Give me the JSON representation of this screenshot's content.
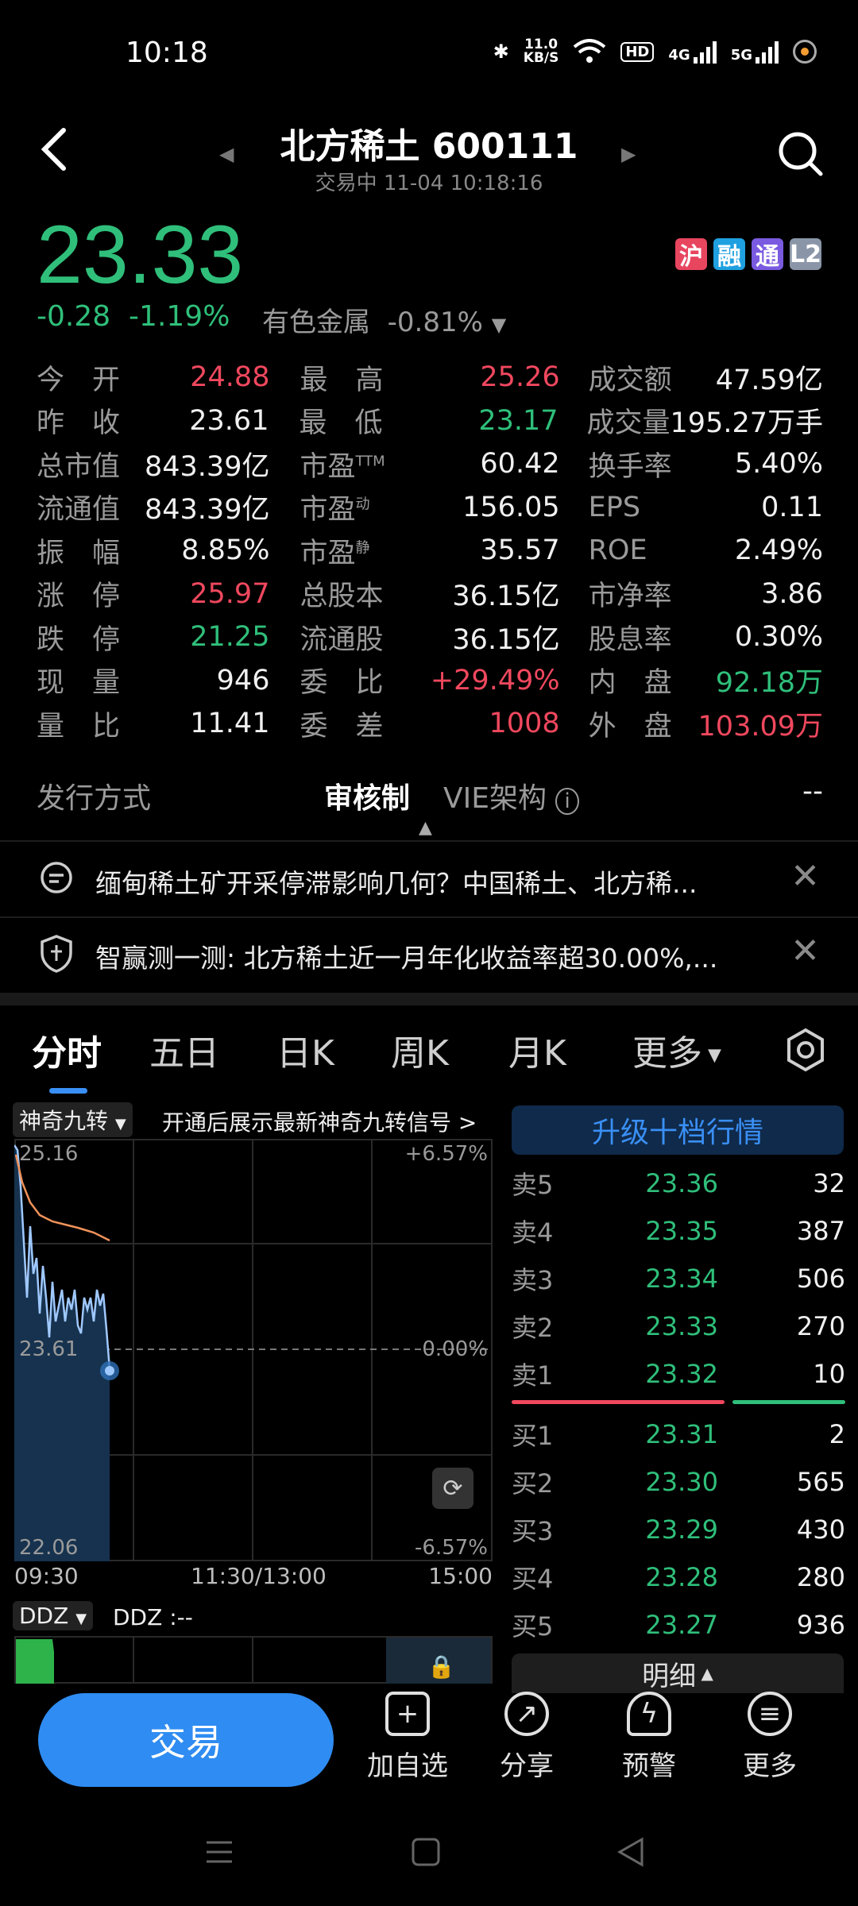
{
  "status": {
    "time": "10:18",
    "speed": "11.0",
    "speed_unit": "KB/S",
    "hd": "HD",
    "net1": "4G",
    "net2": "5G"
  },
  "header": {
    "title": "北方稀土 600111",
    "subtitle": "交易中 11-04 10:18:16"
  },
  "quote": {
    "price": "23.33",
    "change": "-0.28",
    "change_pct": "-1.19%",
    "sector": "有色金属",
    "sector_pct": "-0.81%",
    "tags": [
      "沪",
      "融",
      "通",
      "L2"
    ],
    "tag_colors": [
      "#e8455f",
      "#1fa0e0",
      "#7a5ae0",
      "#8a96a8"
    ]
  },
  "stats": [
    [
      {
        "l": "今　开",
        "v": "24.88",
        "c": "red"
      },
      {
        "l": "最　高",
        "v": "25.26",
        "c": "red"
      },
      {
        "l": "成交额",
        "v": "47.59亿",
        "c": ""
      }
    ],
    [
      {
        "l": "昨　收",
        "v": "23.61",
        "c": ""
      },
      {
        "l": "最　低",
        "v": "23.17",
        "c": "green"
      },
      {
        "l": "成交量",
        "v": "195.27万手",
        "c": ""
      }
    ],
    [
      {
        "l": "总市值",
        "v": "843.39亿",
        "c": ""
      },
      {
        "l": "市盈TTM",
        "v": "60.42",
        "c": ""
      },
      {
        "l": "换手率",
        "v": "5.40%",
        "c": ""
      }
    ],
    [
      {
        "l": "流通值",
        "v": "843.39亿",
        "c": ""
      },
      {
        "l": "市盈动",
        "v": "156.05",
        "c": ""
      },
      {
        "l": "EPS",
        "v": "0.11",
        "c": ""
      }
    ],
    [
      {
        "l": "振　幅",
        "v": "8.85%",
        "c": ""
      },
      {
        "l": "市盈静",
        "v": "35.57",
        "c": ""
      },
      {
        "l": "ROE",
        "v": "2.49%",
        "c": ""
      }
    ],
    [
      {
        "l": "涨　停",
        "v": "25.97",
        "c": "red"
      },
      {
        "l": "总股本",
        "v": "36.15亿",
        "c": ""
      },
      {
        "l": "市净率",
        "v": "3.86",
        "c": ""
      }
    ],
    [
      {
        "l": "跌　停",
        "v": "21.25",
        "c": "green"
      },
      {
        "l": "流通股",
        "v": "36.15亿",
        "c": ""
      },
      {
        "l": "股息率",
        "v": "0.30%",
        "c": ""
      }
    ],
    [
      {
        "l": "现　量",
        "v": "946",
        "c": ""
      },
      {
        "l": "委　比",
        "v": "+29.49%",
        "c": "red"
      },
      {
        "l": "内　盘",
        "v": "92.18万",
        "c": "green"
      }
    ],
    [
      {
        "l": "量　比",
        "v": "11.41",
        "c": ""
      },
      {
        "l": "委　差",
        "v": "1008",
        "c": "red"
      },
      {
        "l": "外　盘",
        "v": "103.09万",
        "c": "red"
      }
    ]
  ],
  "issue": {
    "label": "发行方式",
    "value": "审核制",
    "vie": "VIE架构",
    "vie_value": "--"
  },
  "news": [
    {
      "text": "缅甸稀土矿开采停滞影响几何？中国稀土、北方稀..."
    },
    {
      "text": "智赢测一测: 北方稀土近一月年化收益率超30.00%,..."
    }
  ],
  "tabs": [
    "分时",
    "五日",
    "日K",
    "周K",
    "月K",
    "更多"
  ],
  "chart": {
    "indicator": "神奇九转",
    "tip": "开通后展示最新神奇九转信号 >",
    "y_top": "25.16",
    "y_mid": "23.61",
    "y_bot": "22.06",
    "pct_top": "+6.57%",
    "pct_mid": "0.00%",
    "pct_bot": "-6.57%",
    "x_labels": [
      "09:30",
      "11:30/13:00",
      "15:00"
    ],
    "sub_indicator": "DDZ",
    "sub_value": "DDZ :--"
  },
  "orderbook": {
    "upgrade": "升级十档行情",
    "asks": [
      {
        "l": "卖5",
        "p": "23.36",
        "v": "32"
      },
      {
        "l": "卖4",
        "p": "23.35",
        "v": "387"
      },
      {
        "l": "卖3",
        "p": "23.34",
        "v": "506"
      },
      {
        "l": "卖2",
        "p": "23.33",
        "v": "270"
      },
      {
        "l": "卖1",
        "p": "23.32",
        "v": "10"
      }
    ],
    "bids": [
      {
        "l": "买1",
        "p": "23.31",
        "v": "2"
      },
      {
        "l": "买2",
        "p": "23.30",
        "v": "565"
      },
      {
        "l": "买3",
        "p": "23.29",
        "v": "430"
      },
      {
        "l": "买4",
        "p": "23.28",
        "v": "280"
      },
      {
        "l": "买5",
        "p": "23.27",
        "v": "936"
      }
    ],
    "detail": "明细"
  },
  "bottom": {
    "trade": "交易",
    "items": [
      "加自选",
      "分享",
      "预警",
      "更多"
    ]
  }
}
